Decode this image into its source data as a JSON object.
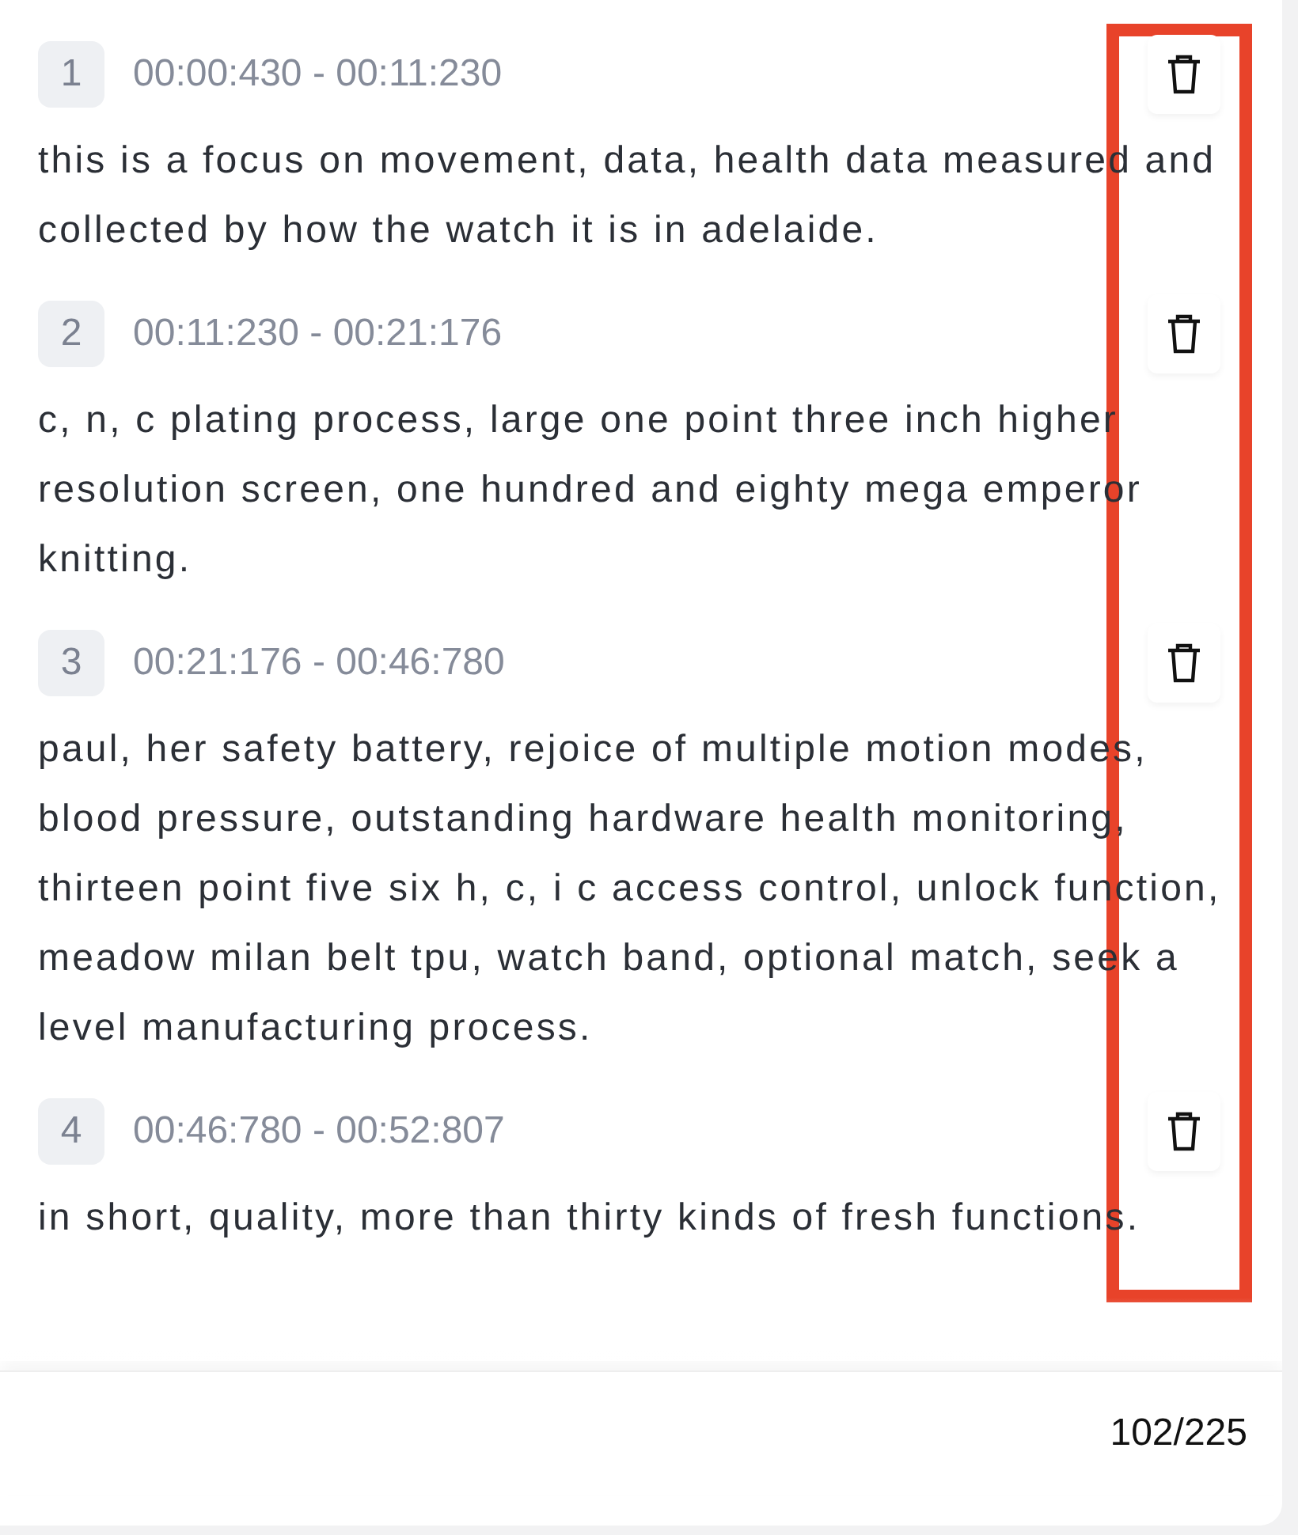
{
  "segments": [
    {
      "index": "1",
      "time_range": "00:00:430 - 00:11:230",
      "text": "this is a focus on movement, data, health data measured and collected by how the watch it is in adelaide."
    },
    {
      "index": "2",
      "time_range": "00:11:230 - 00:21:176",
      "text": "c, n, c plating process, large one point three inch higher resolution screen, one hundred and eighty mega emperor knitting."
    },
    {
      "index": "3",
      "time_range": "00:21:176 - 00:46:780",
      "text": "paul, her safety battery, rejoice of multiple motion modes, blood pressure, outstanding hardware health monitoring, thirteen point five six h, c, i c access control, unlock function, meadow milan belt tpu, watch band, optional match, seek a level manufacturing process."
    },
    {
      "index": "4",
      "time_range": "00:46:780 - 00:52:807",
      "text": "in short, quality, more than thirty kinds of fresh functions."
    }
  ],
  "counter": "102/225"
}
